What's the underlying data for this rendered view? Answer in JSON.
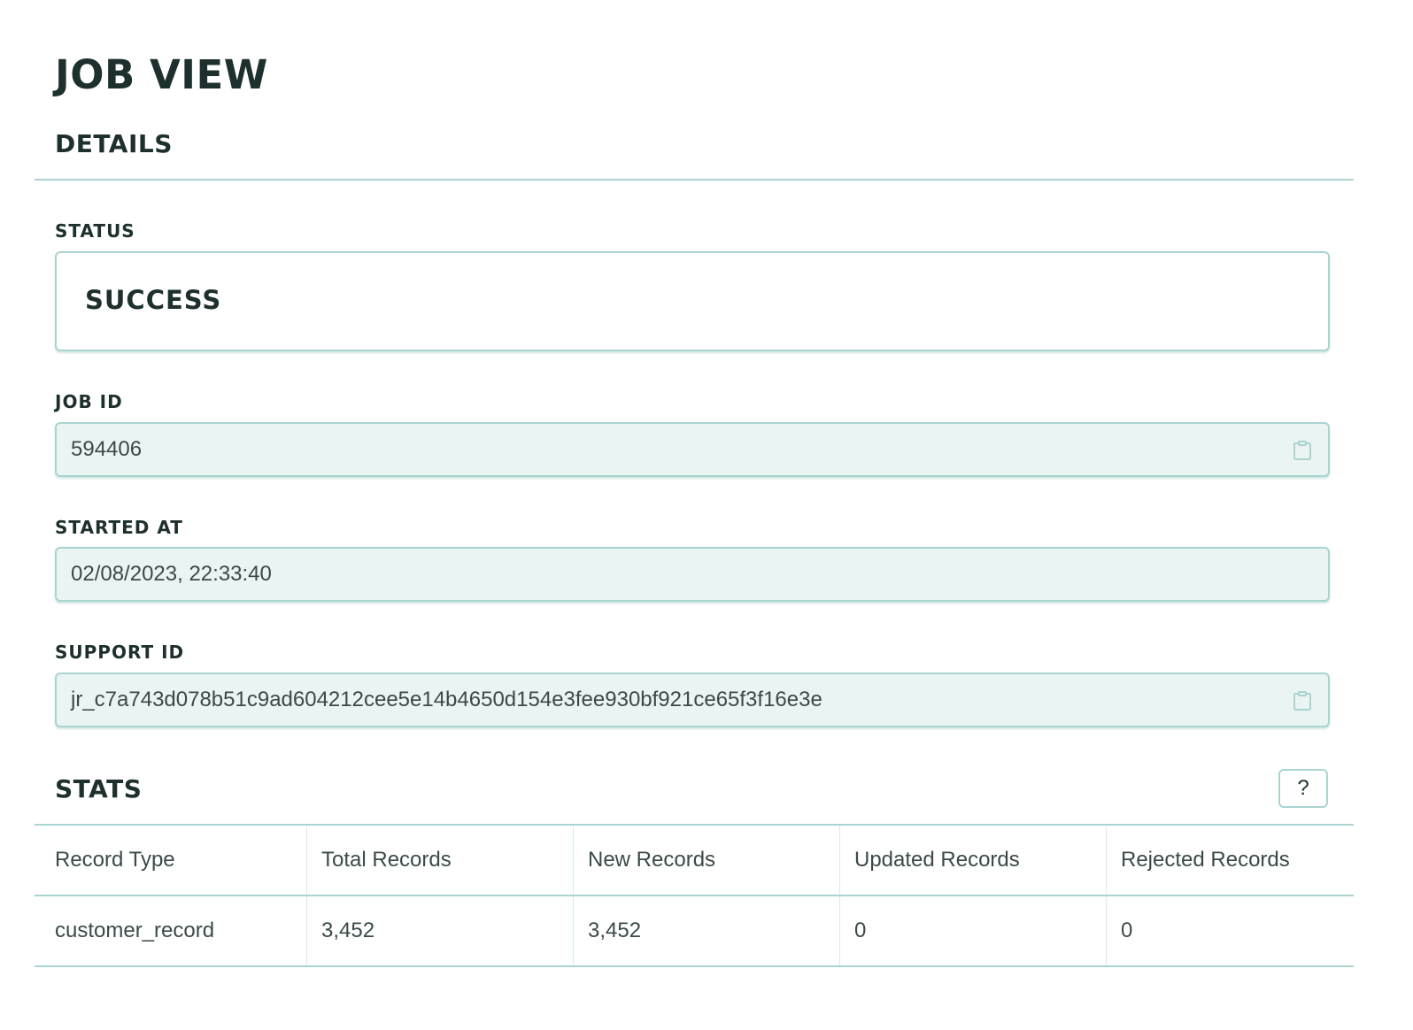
{
  "page": {
    "title": "JOB VIEW"
  },
  "details": {
    "section_title": "DETAILS",
    "status": {
      "label": "STATUS",
      "value": "SUCCESS"
    },
    "job_id": {
      "label": "JOB ID",
      "value": "594406"
    },
    "started_at": {
      "label": "STARTED AT",
      "value": "02/08/2023, 22:33:40"
    },
    "support_id": {
      "label": "SUPPORT ID",
      "value": "jr_c7a743d078b51c9ad604212cee5e14b4650d154e3fee930bf921ce65f3f16e3e"
    }
  },
  "stats": {
    "section_title": "STATS",
    "help_label": "?",
    "columns": [
      "Record Type",
      "Total Records",
      "New Records",
      "Updated Records",
      "Rejected Records"
    ],
    "rows": [
      [
        "customer_record",
        "3,452",
        "3,452",
        "0",
        "0"
      ]
    ]
  },
  "icons": {
    "copy": "clipboard-icon"
  },
  "colors": {
    "accent_border": "#a9d4cf",
    "readonly_bg": "#eaf4f3",
    "heading_text": "#1e302e",
    "body_text": "#3b4a49"
  }
}
